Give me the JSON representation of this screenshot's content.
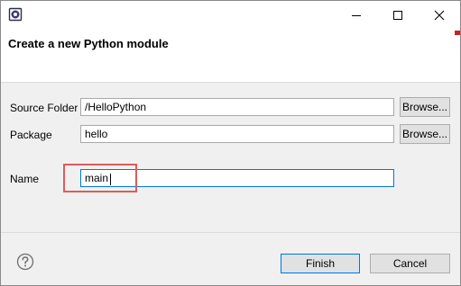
{
  "window": {
    "banner_title": "Create a new Python module",
    "accent_color": "#0078d7",
    "icons": [
      "app-icon",
      "minimize-icon",
      "maximize-icon",
      "close-icon",
      "help-icon"
    ]
  },
  "form": {
    "source_folder_label": "Source Folder",
    "source_folder_value": "/HelloPython",
    "package_label": "Package",
    "package_value": "hello",
    "name_label": "Name",
    "name_value": "main",
    "browse_label": "Browse..."
  },
  "footer": {
    "finish_label": "Finish",
    "cancel_label": "Cancel"
  }
}
